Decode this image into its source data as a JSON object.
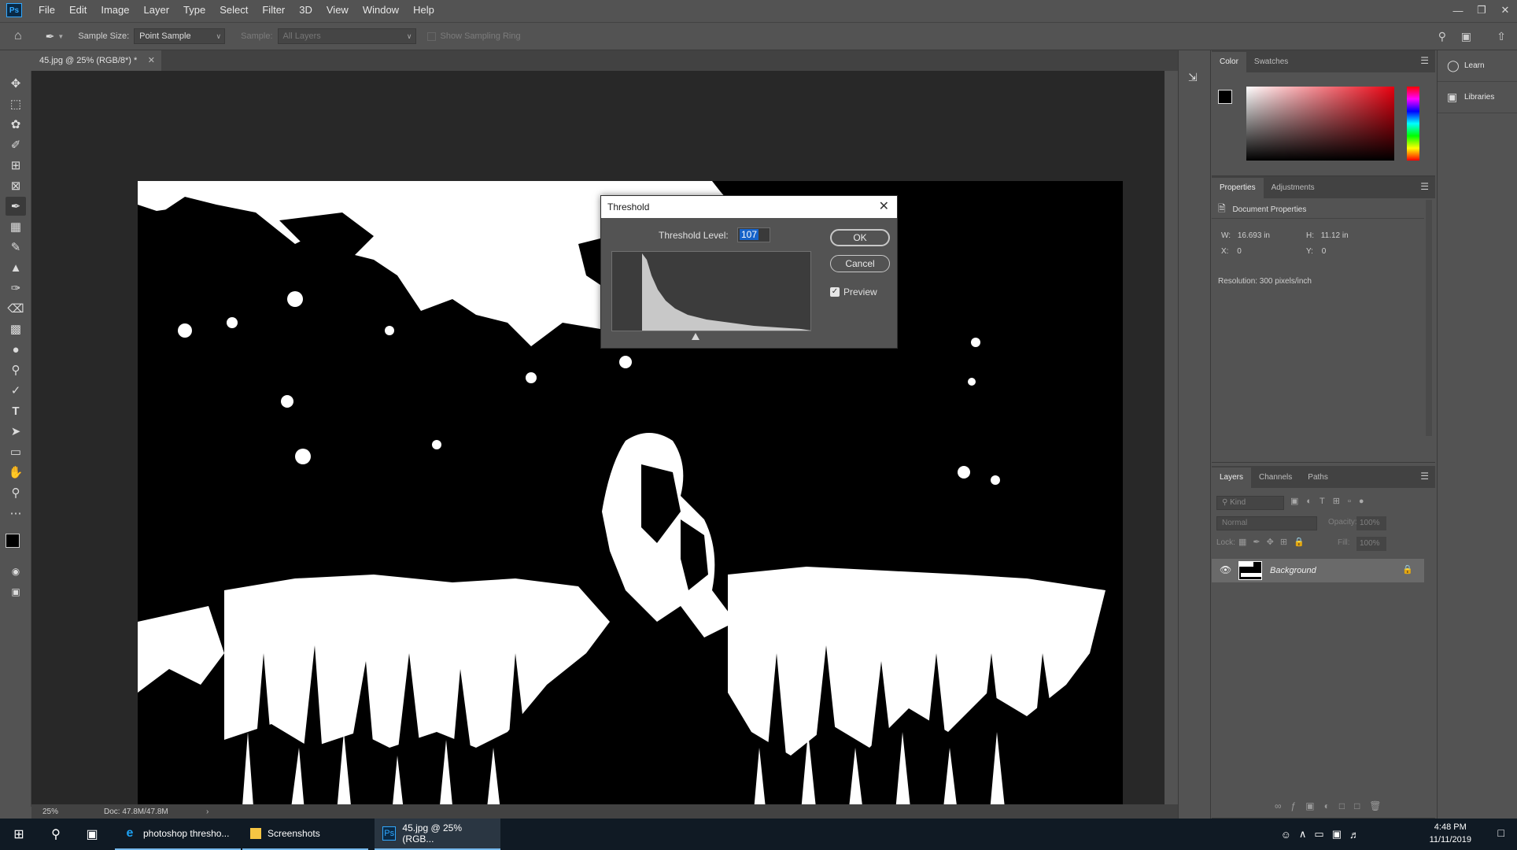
{
  "app": {
    "logo": "Ps",
    "menu": [
      "File",
      "Edit",
      "Image",
      "Layer",
      "Type",
      "Select",
      "Filter",
      "3D",
      "View",
      "Window",
      "Help"
    ]
  },
  "options_bar": {
    "sample_size_label": "Sample Size:",
    "sample_size_value": "Point Sample",
    "sample_label": "Sample:",
    "sample_value": "All Layers",
    "show_ring_label": "Show Sampling Ring"
  },
  "document": {
    "tab_title": "45.jpg @ 25% (RGB/8*) *",
    "zoom": "25%",
    "doc_size": "Doc: 47.8M/47.8M"
  },
  "color_panel": {
    "tabs": [
      "Color",
      "Swatches"
    ]
  },
  "properties_panel": {
    "tabs": [
      "Properties",
      "Adjustments"
    ],
    "heading": "Document Properties",
    "w_label": "W:",
    "w_value": "16.693 in",
    "h_label": "H:",
    "h_value": "11.12 in",
    "x_label": "X:",
    "x_value": "0",
    "y_label": "Y:",
    "y_value": "0",
    "resolution": "Resolution: 300 pixels/inch"
  },
  "layers_panel": {
    "tabs": [
      "Layers",
      "Channels",
      "Paths"
    ],
    "kind_placeholder": "Kind",
    "blend_mode": "Normal",
    "opacity_label": "Opacity:",
    "opacity_value": "100%",
    "lock_label": "Lock:",
    "fill_label": "Fill:",
    "fill_value": "100%",
    "layer_name": "Background"
  },
  "right_dock": {
    "learn": "Learn",
    "libraries": "Libraries"
  },
  "threshold_dialog": {
    "title": "Threshold",
    "level_label": "Threshold Level:",
    "level_value": "107",
    "ok": "OK",
    "cancel": "Cancel",
    "preview": "Preview"
  },
  "taskbar": {
    "apps": [
      "photoshop thresho...",
      "Screenshots",
      "45.jpg @ 25% (RGB..."
    ],
    "time": "4:48 PM",
    "date": "11/11/2019"
  },
  "colors": {
    "ui_gray": "#535353",
    "canvas_bg": "#282828",
    "accent_blue": "#31a8ff",
    "taskbar": "#101a24"
  }
}
